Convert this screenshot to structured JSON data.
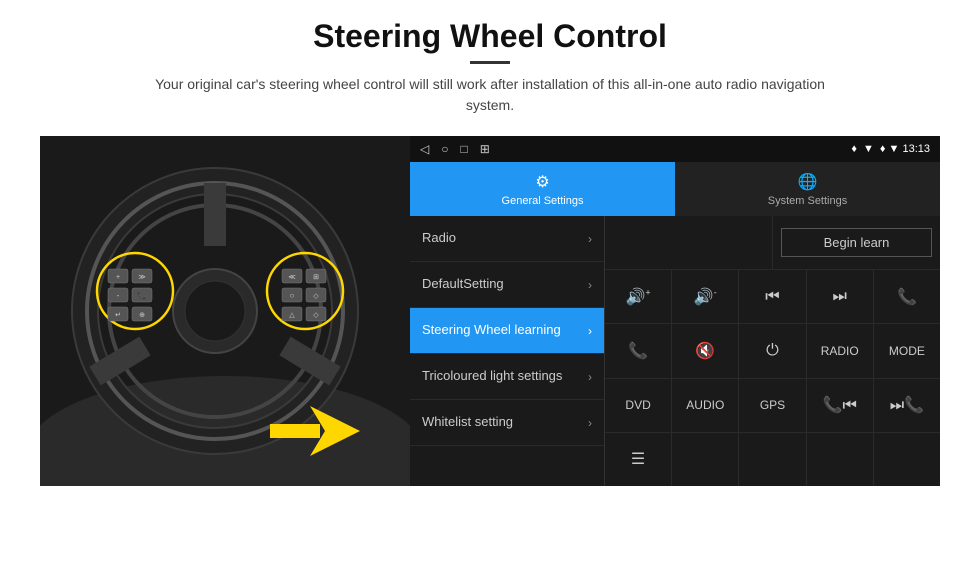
{
  "header": {
    "title": "Steering Wheel Control",
    "divider": true,
    "subtitle": "Your original car's steering wheel control will still work after installation of this all-in-one auto radio navigation system."
  },
  "status_bar": {
    "icons": [
      "◁",
      "○",
      "□",
      "⊞"
    ],
    "right": "♦ ▼ 13:13"
  },
  "tabs": [
    {
      "id": "general",
      "label": "General Settings",
      "active": true
    },
    {
      "id": "system",
      "label": "System Settings",
      "active": false
    }
  ],
  "menu_items": [
    {
      "id": "radio",
      "label": "Radio",
      "active": false
    },
    {
      "id": "default",
      "label": "DefaultSetting",
      "active": false
    },
    {
      "id": "steering",
      "label": "Steering Wheel learning",
      "active": true
    },
    {
      "id": "tricolour",
      "label": "Tricoloured light settings",
      "active": false
    },
    {
      "id": "whitelist",
      "label": "Whitelist setting",
      "active": false
    }
  ],
  "control_rows": [
    {
      "cells": [
        {
          "type": "empty",
          "wide": true
        },
        {
          "type": "button",
          "label": "Begin learn"
        }
      ]
    },
    {
      "cells": [
        {
          "type": "icon",
          "label": "🔊+"
        },
        {
          "type": "icon",
          "label": "🔊-"
        },
        {
          "type": "icon",
          "label": "⏮"
        },
        {
          "type": "icon",
          "label": "⏭"
        },
        {
          "type": "icon",
          "label": "📞"
        }
      ]
    },
    {
      "cells": [
        {
          "type": "icon",
          "label": "📞"
        },
        {
          "type": "icon",
          "label": "🔇"
        },
        {
          "type": "icon",
          "label": "⏻"
        },
        {
          "type": "text",
          "label": "RADIO"
        },
        {
          "type": "text",
          "label": "MODE"
        }
      ]
    },
    {
      "cells": [
        {
          "type": "text",
          "label": "DVD"
        },
        {
          "type": "text",
          "label": "AUDIO"
        },
        {
          "type": "text",
          "label": "GPS"
        },
        {
          "type": "icon",
          "label": "📞⏮"
        },
        {
          "type": "icon",
          "label": "⏭📞"
        }
      ]
    },
    {
      "cells": [
        {
          "type": "icon",
          "label": "☰"
        }
      ]
    }
  ]
}
